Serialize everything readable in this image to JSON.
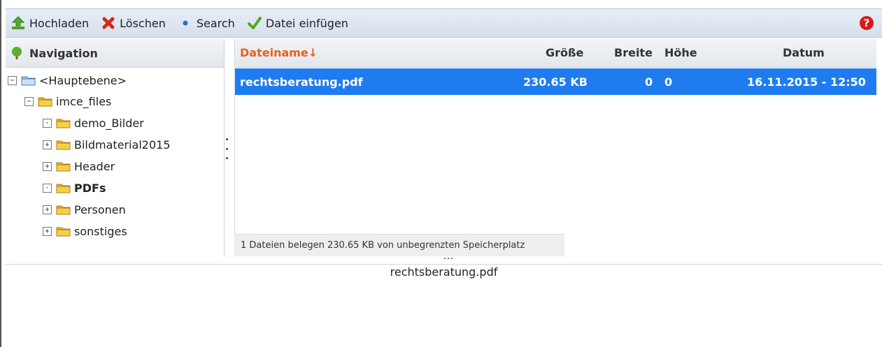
{
  "toolbar": {
    "upload_label": "Hochladen",
    "delete_label": "Löschen",
    "search_label": "Search",
    "insert_label": "Datei einfügen",
    "help_label": "?"
  },
  "navigation": {
    "title": "Navigation",
    "tree": [
      {
        "label": "<Hauptebene>",
        "expander": "−"
      },
      {
        "label": "imce_files",
        "expander": "−"
      },
      {
        "label": "demo_Bilder",
        "expander": "·"
      },
      {
        "label": "Bildmaterial2015",
        "expander": "+"
      },
      {
        "label": "Header",
        "expander": "+"
      },
      {
        "label": "PDFs",
        "expander": "·"
      },
      {
        "label": "Personen",
        "expander": "+"
      },
      {
        "label": "sonstiges",
        "expander": "+"
      }
    ]
  },
  "files": {
    "columns": {
      "name": "Dateiname↓",
      "size": "Größe",
      "width": "Breite",
      "height": "Höhe",
      "date": "Datum"
    },
    "rows": [
      {
        "name": "rechtsberatung.pdf",
        "size": "230.65 KB",
        "width": "0",
        "height": "0",
        "date": "16.11.2015 - 12:50"
      }
    ],
    "status": "1 Dateien belegen 230.65 KB von unbegrenzten Speicherplatz"
  },
  "preview": {
    "filename": "rechtsberatung.pdf"
  },
  "colors": {
    "selected_row": "#1f7cf0",
    "sort_header": "#e8601c",
    "folder": "#f2c230"
  }
}
